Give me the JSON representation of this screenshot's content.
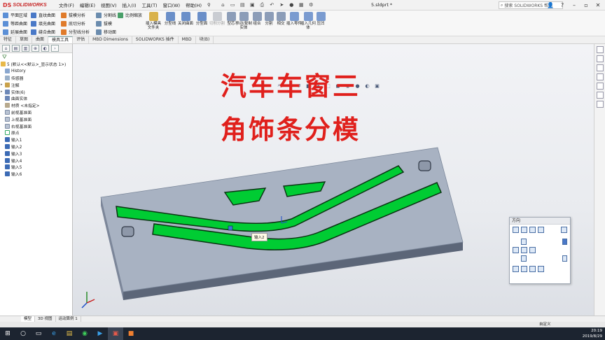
{
  "titlebar": {
    "logo_mark": "DS",
    "logo_text": "SOLIDWORKS",
    "menu": [
      "文件(F)",
      "编辑(E)",
      "视图(V)",
      "插入(I)",
      "工具(T)",
      "窗口(W)",
      "帮助(H)"
    ],
    "document": "5.sldprt *",
    "search_placeholder": "搜索 SOLIDWORKS 帮助"
  },
  "ribbon": {
    "col1": [
      "平面区域",
      "等距曲面",
      "延展曲面"
    ],
    "col2": [
      "直纹曲面",
      "填充曲面",
      "缝合曲面"
    ],
    "col3": [
      "拔模分析",
      "底切分析",
      "分型线分析"
    ],
    "col4": [
      "分割线",
      "拔模",
      "移动面"
    ],
    "col5": [
      "比例缩放"
    ],
    "big": [
      "插入模具文件夹",
      "分型线",
      "关闭曲面",
      "分型面",
      "切削分割",
      "型芯",
      "移动/复制实体",
      "组合",
      "分割",
      "相交",
      "插入零件",
      "插入几何体",
      "压凹"
    ]
  },
  "tabs": [
    "特征",
    "草图",
    "曲面",
    "模具工具",
    "评估",
    "MBD Dimensions",
    "SOLIDWORKS 插件",
    "MBD",
    "块(B)"
  ],
  "active_tab": "模具工具",
  "tree": {
    "root": "5 (默认<<默认>_显示状态 1>)",
    "items": [
      "History",
      "传感器",
      "注解",
      "实体(6)",
      "曲面实体",
      "材质 <未指定>",
      "前视基准面",
      "上视基准面",
      "右视基准面",
      "原点",
      "输入1",
      "输入2",
      "输入3",
      "输入4",
      "输入5",
      "输入6"
    ]
  },
  "overlay": {
    "line1": "汽车车窗三",
    "line2": "角饰条分模"
  },
  "tooltip": "输入2",
  "orientation": {
    "title": "方向"
  },
  "bottom_tabs": [
    "模型",
    "3D 视图",
    "运动算例 1"
  ],
  "status": {
    "mode": "自定义"
  },
  "taskbar": {
    "time": "20:19",
    "date": "2019/8/29"
  },
  "colors": {
    "plate_top": "#a8b2c2",
    "plate_side": "#5c6678",
    "trim": "#00cc33",
    "title_red": "#e0201c"
  }
}
